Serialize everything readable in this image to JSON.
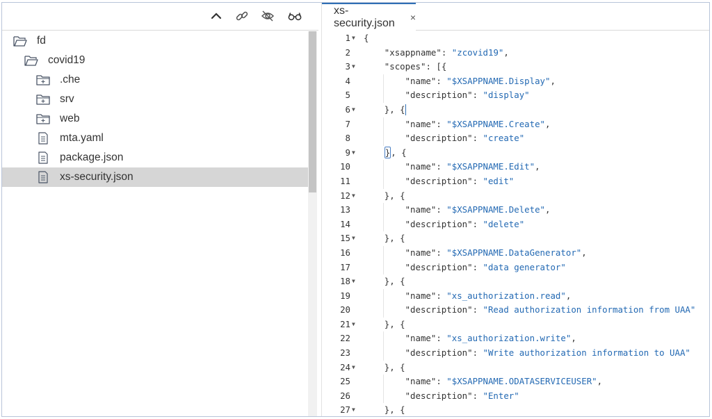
{
  "explorer": {
    "toolbar": {
      "icons": [
        "collapse-icon",
        "link-icon",
        "hide-icon",
        "glasses-icon"
      ]
    },
    "tree": [
      {
        "label": "fd",
        "kind": "folder-open",
        "depth": 0
      },
      {
        "label": "covid19",
        "kind": "folder-open",
        "depth": 1
      },
      {
        "label": ".che",
        "kind": "folder-closed",
        "depth": 2
      },
      {
        "label": "srv",
        "kind": "folder-closed",
        "depth": 2
      },
      {
        "label": "web",
        "kind": "folder-closed",
        "depth": 2
      },
      {
        "label": "mta.yaml",
        "kind": "file",
        "depth": 2
      },
      {
        "label": "package.json",
        "kind": "file",
        "depth": 2
      },
      {
        "label": "xs-security.json",
        "kind": "file",
        "depth": 2,
        "selected": true
      }
    ]
  },
  "editor": {
    "tab": {
      "label": "xs-security.json",
      "close": "×"
    },
    "lines": [
      {
        "n": "1",
        "fold": true,
        "indent": 0,
        "parts": [
          [
            "p",
            "{"
          ]
        ]
      },
      {
        "n": "2",
        "fold": false,
        "indent": 1,
        "parts": [
          [
            "k",
            "\"xsappname\""
          ],
          [
            "p",
            ": "
          ],
          [
            "s",
            "\"zcovid19\""
          ],
          [
            "p",
            ","
          ]
        ]
      },
      {
        "n": "3",
        "fold": true,
        "indent": 1,
        "parts": [
          [
            "k",
            "\"scopes\""
          ],
          [
            "p",
            ": [{"
          ]
        ]
      },
      {
        "n": "4",
        "fold": false,
        "indent": 2,
        "parts": [
          [
            "k",
            "\"name\""
          ],
          [
            "p",
            ": "
          ],
          [
            "s",
            "\"$XSAPPNAME.Display\""
          ],
          [
            "p",
            ","
          ]
        ]
      },
      {
        "n": "5",
        "fold": false,
        "indent": 2,
        "parts": [
          [
            "k",
            "\"description\""
          ],
          [
            "p",
            ": "
          ],
          [
            "s",
            "\"display\""
          ]
        ]
      },
      {
        "n": "6",
        "fold": true,
        "indent": 1,
        "parts": [
          [
            "p",
            "}, {"
          ]
        ],
        "caret": true
      },
      {
        "n": "7",
        "fold": false,
        "indent": 2,
        "parts": [
          [
            "k",
            "\"name\""
          ],
          [
            "p",
            ": "
          ],
          [
            "s",
            "\"$XSAPPNAME.Create\""
          ],
          [
            "p",
            ","
          ]
        ]
      },
      {
        "n": "8",
        "fold": false,
        "indent": 2,
        "parts": [
          [
            "k",
            "\"description\""
          ],
          [
            "p",
            ": "
          ],
          [
            "s",
            "\"create\""
          ]
        ]
      },
      {
        "n": "9",
        "fold": true,
        "indent": 1,
        "parts": [
          [
            "b",
            "}"
          ],
          [
            "p",
            ", {"
          ]
        ]
      },
      {
        "n": "10",
        "fold": false,
        "indent": 2,
        "parts": [
          [
            "k",
            "\"name\""
          ],
          [
            "p",
            ": "
          ],
          [
            "s",
            "\"$XSAPPNAME.Edit\""
          ],
          [
            "p",
            ","
          ]
        ]
      },
      {
        "n": "11",
        "fold": false,
        "indent": 2,
        "parts": [
          [
            "k",
            "\"description\""
          ],
          [
            "p",
            ": "
          ],
          [
            "s",
            "\"edit\""
          ]
        ]
      },
      {
        "n": "12",
        "fold": true,
        "indent": 1,
        "parts": [
          [
            "p",
            "}, {"
          ]
        ]
      },
      {
        "n": "13",
        "fold": false,
        "indent": 2,
        "parts": [
          [
            "k",
            "\"name\""
          ],
          [
            "p",
            ": "
          ],
          [
            "s",
            "\"$XSAPPNAME.Delete\""
          ],
          [
            "p",
            ","
          ]
        ]
      },
      {
        "n": "14",
        "fold": false,
        "indent": 2,
        "parts": [
          [
            "k",
            "\"description\""
          ],
          [
            "p",
            ": "
          ],
          [
            "s",
            "\"delete\""
          ]
        ]
      },
      {
        "n": "15",
        "fold": true,
        "indent": 1,
        "parts": [
          [
            "p",
            "}, {"
          ]
        ]
      },
      {
        "n": "16",
        "fold": false,
        "indent": 2,
        "parts": [
          [
            "k",
            "\"name\""
          ],
          [
            "p",
            ": "
          ],
          [
            "s",
            "\"$XSAPPNAME.DataGenerator\""
          ],
          [
            "p",
            ","
          ]
        ]
      },
      {
        "n": "17",
        "fold": false,
        "indent": 2,
        "parts": [
          [
            "k",
            "\"description\""
          ],
          [
            "p",
            ": "
          ],
          [
            "s",
            "\"data generator\""
          ]
        ]
      },
      {
        "n": "18",
        "fold": true,
        "indent": 1,
        "parts": [
          [
            "p",
            "}, {"
          ]
        ]
      },
      {
        "n": "19",
        "fold": false,
        "indent": 2,
        "parts": [
          [
            "k",
            "\"name\""
          ],
          [
            "p",
            ": "
          ],
          [
            "s",
            "\"xs_authorization.read\""
          ],
          [
            "p",
            ","
          ]
        ]
      },
      {
        "n": "20",
        "fold": false,
        "indent": 2,
        "parts": [
          [
            "k",
            "\"description\""
          ],
          [
            "p",
            ": "
          ],
          [
            "s",
            "\"Read authorization information from UAA\""
          ]
        ]
      },
      {
        "n": "21",
        "fold": true,
        "indent": 1,
        "parts": [
          [
            "p",
            "}, {"
          ]
        ]
      },
      {
        "n": "22",
        "fold": false,
        "indent": 2,
        "parts": [
          [
            "k",
            "\"name\""
          ],
          [
            "p",
            ": "
          ],
          [
            "s",
            "\"xs_authorization.write\""
          ],
          [
            "p",
            ","
          ]
        ]
      },
      {
        "n": "23",
        "fold": false,
        "indent": 2,
        "parts": [
          [
            "k",
            "\"description\""
          ],
          [
            "p",
            ": "
          ],
          [
            "s",
            "\"Write authorization information to UAA\""
          ]
        ]
      },
      {
        "n": "24",
        "fold": true,
        "indent": 1,
        "parts": [
          [
            "p",
            "}, {"
          ]
        ]
      },
      {
        "n": "25",
        "fold": false,
        "indent": 2,
        "parts": [
          [
            "k",
            "\"name\""
          ],
          [
            "p",
            ": "
          ],
          [
            "s",
            "\"$XSAPPNAME.ODATASERVICEUSER\""
          ],
          [
            "p",
            ","
          ]
        ]
      },
      {
        "n": "26",
        "fold": false,
        "indent": 2,
        "parts": [
          [
            "k",
            "\"description\""
          ],
          [
            "p",
            ": "
          ],
          [
            "s",
            "\"Enter\""
          ]
        ]
      },
      {
        "n": "27",
        "fold": true,
        "indent": 1,
        "parts": [
          [
            "p",
            "}, {"
          ]
        ]
      }
    ]
  },
  "colors": {
    "string": "#2369b3",
    "tab_accent": "#2f6fb5",
    "selection": "#d6d6d6",
    "frame_border": "#b8c4d9"
  }
}
